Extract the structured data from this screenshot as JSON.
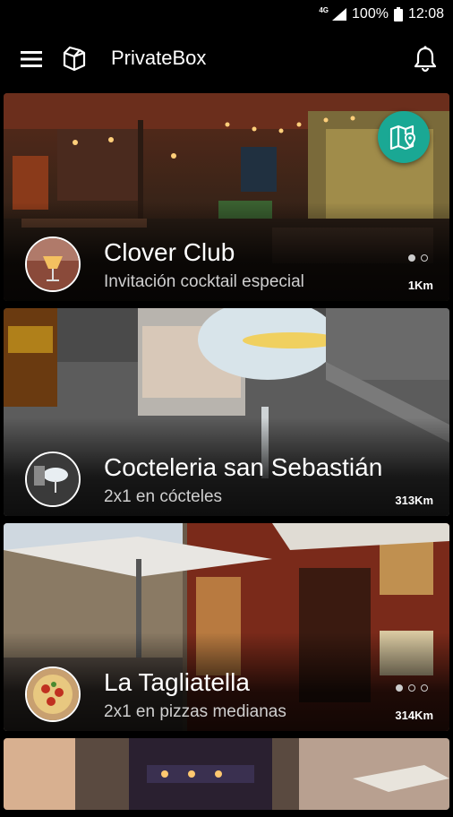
{
  "status_bar": {
    "network": "4G",
    "battery": "100%",
    "time": "12:08"
  },
  "app_bar": {
    "title": "PrivateBox",
    "menu_icon": "hamburger-menu-icon",
    "logo_icon": "box-icon",
    "notification_icon": "bell-icon"
  },
  "map_button": {
    "icon": "map-pin-icon",
    "color": "#1aa894"
  },
  "venues": [
    {
      "name": "Clover Club",
      "offer": "Invitación cocktail especial",
      "distance": "1Km",
      "dots": 2,
      "active_dot": 0
    },
    {
      "name": "Cocteleria san Sebastián",
      "offer": "2x1 en cócteles",
      "distance": "313Km",
      "dots": 0,
      "active_dot": -1
    },
    {
      "name": "La Tagliatella",
      "offer": "2x1 en pizzas medianas",
      "distance": "314Km",
      "dots": 3,
      "active_dot": 0
    }
  ]
}
